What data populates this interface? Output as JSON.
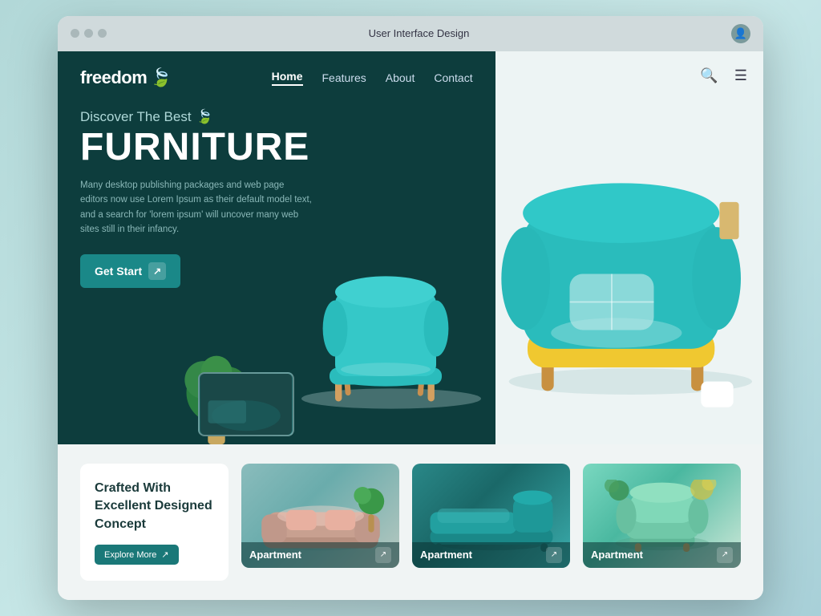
{
  "browser": {
    "title": "User Interface Design",
    "user_icon": "👤"
  },
  "navbar": {
    "logo": "freedom",
    "links": [
      {
        "label": "Home",
        "active": true
      },
      {
        "label": "Features",
        "active": false
      },
      {
        "label": "About",
        "active": false
      },
      {
        "label": "Contact",
        "active": false
      }
    ],
    "search_icon": "🔍",
    "menu_icon": "☰"
  },
  "hero": {
    "discover": "Discover The Best",
    "headline": "FURNITURE",
    "description": "Many desktop publishing packages and web page editors now use Lorem Ipsum as their default model text, and a search for 'lorem ipsum' will uncover many web sites still in their infancy.",
    "cta_button": "Get Start",
    "cta_arrow": "↗"
  },
  "bottom": {
    "crafted_title": "Crafted With Excellent Designed Concept",
    "explore_button": "Explore More",
    "explore_arrow": "↗",
    "apartments": [
      {
        "label": "Apartment",
        "arrow": "↗"
      },
      {
        "label": "Apartment",
        "arrow": "↗"
      },
      {
        "label": "Apartment",
        "arrow": "↗"
      }
    ]
  },
  "icons": {
    "play": "▶",
    "arrow_ne": "↗",
    "search": "⌕",
    "hamburger": "≡",
    "leaf": "🍃"
  }
}
